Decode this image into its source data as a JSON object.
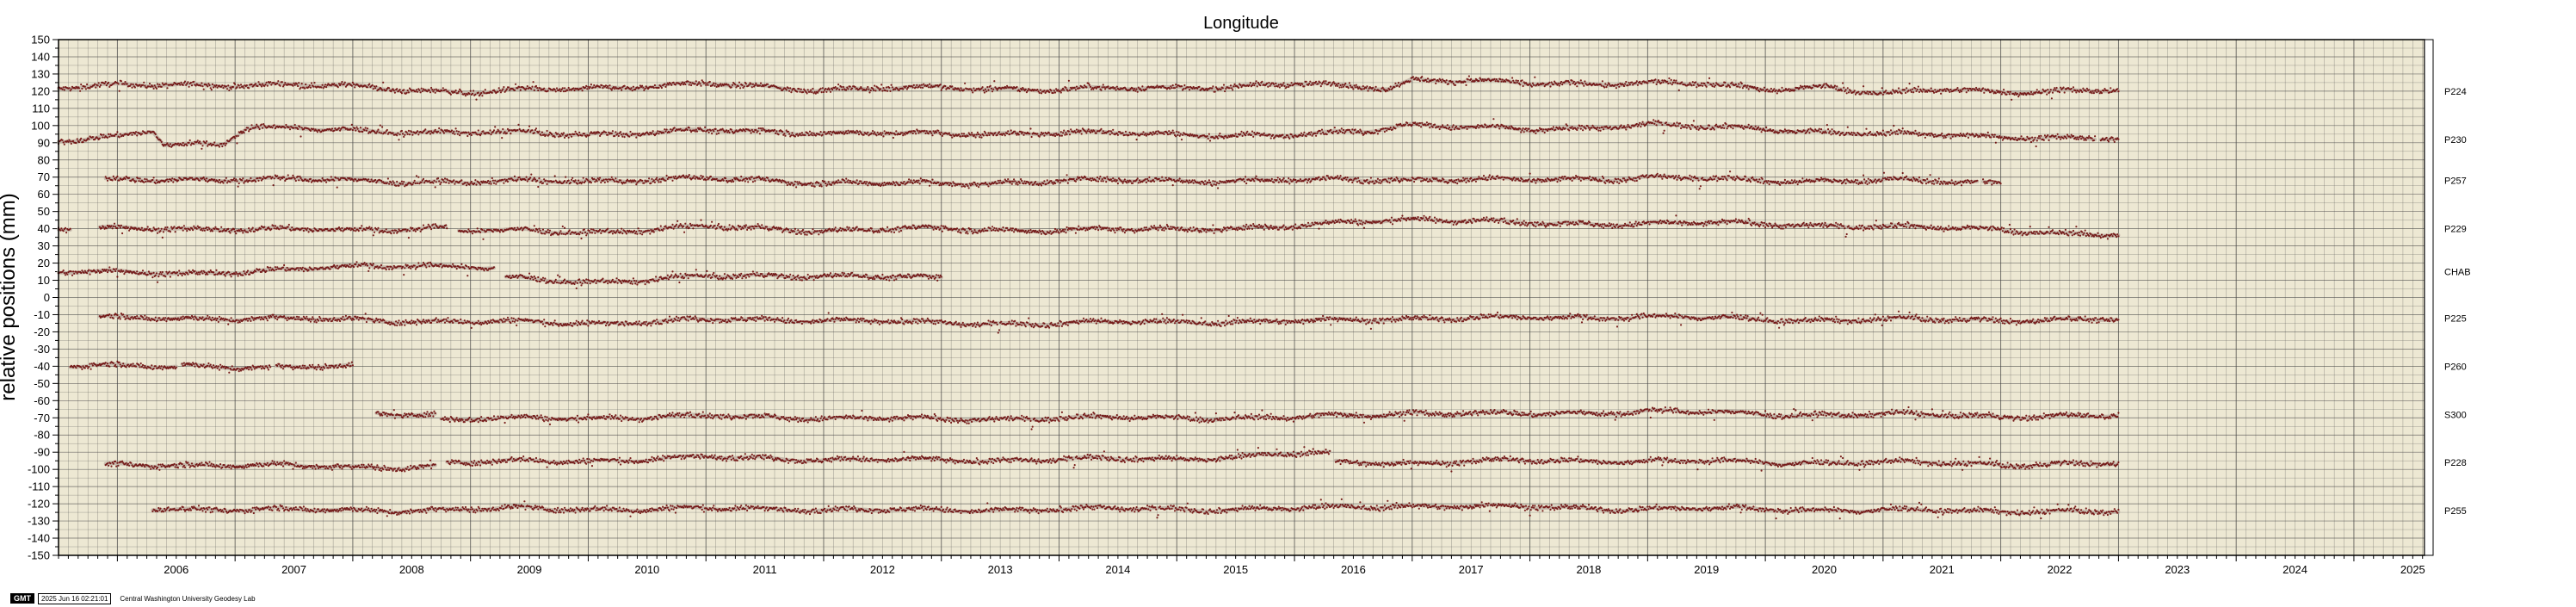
{
  "colors": {
    "plot_background": "#ede8d3",
    "grid": "#444444",
    "points": "#6b0a0a",
    "smooth_band": "#bfb3a6"
  },
  "footer": {
    "badge": "GMT",
    "timestamp": "2025 Jun 16 02:21:01",
    "org": "Central Washington University Geodesy Lab"
  },
  "chart_data": {
    "type": "scatter",
    "title": "Longitude",
    "xlabel": "",
    "ylabel": "relative positions (mm)",
    "xlim": [
      2005.5,
      2025.6
    ],
    "ylim": [
      -150,
      150
    ],
    "x_ticks": [
      "2006",
      "2007",
      "2008",
      "2009",
      "2010",
      "2011",
      "2012",
      "2013",
      "2014",
      "2015",
      "2016",
      "2017",
      "2018",
      "2019",
      "2020",
      "2021",
      "2022",
      "2023",
      "2024",
      "2025"
    ],
    "y_ticks": [
      "150",
      "140",
      "130",
      "120",
      "110",
      "100",
      "90",
      "80",
      "70",
      "60",
      "50",
      "40",
      "30",
      "20",
      "10",
      "0",
      "-10",
      "-20",
      "-30",
      "-40",
      "-50",
      "-60",
      "-70",
      "-80",
      "-90",
      "-100",
      "-110",
      "-120",
      "-130",
      "-140",
      "-150"
    ],
    "grid": true,
    "legend": "station labels at right edge",
    "series": [
      {
        "name": "P224",
        "label_y": 120,
        "segments": [
          {
            "start": 2005.5,
            "end": 2023.0,
            "anchors": [
              [
                2005.5,
                122
              ],
              [
                2006.5,
                124
              ],
              [
                2008.0,
                123
              ],
              [
                2009.0,
                119
              ],
              [
                2010.0,
                122
              ],
              [
                2011.0,
                124
              ],
              [
                2012.0,
                121
              ],
              [
                2013.0,
                122
              ],
              [
                2014.0,
                121
              ],
              [
                2015.0,
                122
              ],
              [
                2016.0,
                124
              ],
              [
                2016.8,
                122
              ],
              [
                2017.0,
                127
              ],
              [
                2017.5,
                126
              ],
              [
                2018.0,
                124
              ],
              [
                2019.0,
                125
              ],
              [
                2019.5,
                124
              ],
              [
                2020.0,
                121
              ],
              [
                2020.5,
                123
              ],
              [
                2021.0,
                118
              ],
              [
                2021.5,
                121
              ],
              [
                2022.0,
                120
              ],
              [
                2022.5,
                120
              ],
              [
                2023.0,
                120
              ]
            ]
          }
        ]
      },
      {
        "name": "P230",
        "label_y": 92,
        "segments": [
          {
            "start": 2005.5,
            "end": 2022.8,
            "anchors": [
              [
                2005.5,
                91
              ],
              [
                2006.0,
                93
              ],
              [
                2006.3,
                97
              ],
              [
                2006.4,
                89
              ],
              [
                2006.9,
                90
              ],
              [
                2007.1,
                99
              ],
              [
                2008.0,
                97
              ],
              [
                2009.0,
                96
              ],
              [
                2010.0,
                95
              ],
              [
                2011.0,
                97
              ],
              [
                2012.0,
                96
              ],
              [
                2013.0,
                95
              ],
              [
                2014.0,
                96
              ],
              [
                2015.0,
                95
              ],
              [
                2016.0,
                94
              ],
              [
                2016.6,
                97
              ],
              [
                2017.0,
                101
              ],
              [
                2017.5,
                99
              ],
              [
                2018.0,
                97
              ],
              [
                2019.0,
                101
              ],
              [
                2019.5,
                99
              ],
              [
                2020.0,
                98
              ],
              [
                2021.0,
                95
              ],
              [
                2022.0,
                94
              ],
              [
                2022.8,
                92
              ]
            ]
          },
          {
            "start": 2022.85,
            "end": 2023.0,
            "anchors": [
              [
                2022.85,
                92
              ],
              [
                2023.0,
                92
              ]
            ]
          }
        ]
      },
      {
        "name": "P257",
        "label_y": 68,
        "segments": [
          {
            "start": 2005.9,
            "end": 2021.8,
            "anchors": [
              [
                2005.9,
                68
              ],
              [
                2007.0,
                69
              ],
              [
                2008.0,
                68
              ],
              [
                2009.0,
                67
              ],
              [
                2010.0,
                68
              ],
              [
                2011.0,
                69
              ],
              [
                2012.0,
                67
              ],
              [
                2013.0,
                66
              ],
              [
                2014.0,
                68
              ],
              [
                2015.0,
                68
              ],
              [
                2016.0,
                68
              ],
              [
                2017.0,
                69
              ],
              [
                2018.0,
                68
              ],
              [
                2019.0,
                70
              ],
              [
                2020.0,
                68
              ],
              [
                2021.0,
                68
              ],
              [
                2021.8,
                67
              ]
            ]
          },
          {
            "start": 2021.85,
            "end": 2022.0,
            "anchors": [
              [
                2021.85,
                67
              ],
              [
                2022.0,
                67
              ]
            ]
          }
        ]
      },
      {
        "name": "P229",
        "label_y": 40,
        "segments": [
          {
            "start": 2005.5,
            "end": 2005.6,
            "anchors": [
              [
                2005.5,
                40
              ],
              [
                2005.6,
                40
              ]
            ]
          },
          {
            "start": 2005.85,
            "end": 2008.8,
            "anchors": [
              [
                2005.85,
                40
              ],
              [
                2007.0,
                40
              ],
              [
                2008.0,
                39
              ],
              [
                2008.8,
                41
              ]
            ]
          },
          {
            "start": 2008.9,
            "end": 2023.0,
            "anchors": [
              [
                2008.9,
                39
              ],
              [
                2010.0,
                38
              ],
              [
                2011.0,
                41
              ],
              [
                2012.0,
                39
              ],
              [
                2013.0,
                40
              ],
              [
                2014.0,
                39
              ],
              [
                2015.0,
                40
              ],
              [
                2016.0,
                41
              ],
              [
                2016.5,
                44
              ],
              [
                2017.0,
                46
              ],
              [
                2018.0,
                43
              ],
              [
                2019.0,
                43
              ],
              [
                2020.0,
                43
              ],
              [
                2021.0,
                41
              ],
              [
                2022.0,
                40
              ],
              [
                2022.5,
                37
              ],
              [
                2023.0,
                36
              ]
            ]
          }
        ]
      },
      {
        "name": "CHAB",
        "label_y": 15,
        "segments": [
          {
            "start": 2005.5,
            "end": 2009.2,
            "anchors": [
              [
                2005.5,
                15
              ],
              [
                2006.5,
                14
              ],
              [
                2007.5,
                16
              ],
              [
                2008.0,
                18
              ],
              [
                2008.5,
                19
              ],
              [
                2009.2,
                17
              ]
            ]
          },
          {
            "start": 2009.3,
            "end": 2013.0,
            "anchors": [
              [
                2009.3,
                11
              ],
              [
                2010.0,
                9
              ],
              [
                2011.0,
                12
              ],
              [
                2012.0,
                13
              ],
              [
                2013.0,
                11
              ]
            ]
          }
        ]
      },
      {
        "name": "P225",
        "label_y": -12,
        "segments": [
          {
            "start": 2005.85,
            "end": 2023.0,
            "anchors": [
              [
                2005.85,
                -12
              ],
              [
                2007.0,
                -12
              ],
              [
                2008.0,
                -13
              ],
              [
                2009.0,
                -14
              ],
              [
                2010.0,
                -15
              ],
              [
                2011.0,
                -13
              ],
              [
                2012.0,
                -13
              ],
              [
                2013.0,
                -15
              ],
              [
                2014.0,
                -15
              ],
              [
                2015.0,
                -14
              ],
              [
                2016.0,
                -14
              ],
              [
                2017.0,
                -12
              ],
              [
                2018.0,
                -12
              ],
              [
                2019.0,
                -11
              ],
              [
                2020.0,
                -13
              ],
              [
                2021.0,
                -13
              ],
              [
                2022.0,
                -13
              ],
              [
                2023.0,
                -13
              ]
            ]
          }
        ]
      },
      {
        "name": "P260",
        "label_y": -40,
        "segments": [
          {
            "start": 2005.6,
            "end": 2006.5,
            "anchors": [
              [
                2005.6,
                -40
              ],
              [
                2006.5,
                -40
              ]
            ]
          },
          {
            "start": 2006.55,
            "end": 2007.3,
            "anchors": [
              [
                2006.55,
                -39
              ],
              [
                2007.3,
                -41
              ]
            ]
          },
          {
            "start": 2007.35,
            "end": 2008.0,
            "anchors": [
              [
                2007.35,
                -41
              ],
              [
                2008.0,
                -40
              ]
            ]
          }
        ]
      },
      {
        "name": "S300",
        "label_y": -68,
        "segments": [
          {
            "start": 2008.2,
            "end": 2008.7,
            "anchors": [
              [
                2008.2,
                -67
              ],
              [
                2008.7,
                -68
              ]
            ]
          },
          {
            "start": 2008.75,
            "end": 2023.0,
            "anchors": [
              [
                2008.75,
                -71
              ],
              [
                2010.0,
                -70
              ],
              [
                2011.0,
                -69
              ],
              [
                2012.0,
                -70
              ],
              [
                2013.0,
                -71
              ],
              [
                2014.0,
                -70
              ],
              [
                2015.0,
                -70
              ],
              [
                2016.0,
                -70
              ],
              [
                2017.0,
                -67
              ],
              [
                2018.0,
                -68
              ],
              [
                2019.0,
                -66
              ],
              [
                2020.0,
                -68
              ],
              [
                2021.0,
                -68
              ],
              [
                2022.0,
                -69
              ],
              [
                2023.0,
                -69
              ]
            ]
          }
        ]
      },
      {
        "name": "P228",
        "label_y": -96,
        "segments": [
          {
            "start": 2005.9,
            "end": 2008.7,
            "anchors": [
              [
                2005.9,
                -98
              ],
              [
                2007.0,
                -97
              ],
              [
                2008.0,
                -99
              ],
              [
                2008.7,
                -98
              ]
            ]
          },
          {
            "start": 2008.8,
            "end": 2016.3,
            "anchors": [
              [
                2008.8,
                -96
              ],
              [
                2010.0,
                -95
              ],
              [
                2011.0,
                -93
              ],
              [
                2012.0,
                -94
              ],
              [
                2013.0,
                -95
              ],
              [
                2014.0,
                -94
              ],
              [
                2015.0,
                -94
              ],
              [
                2016.0,
                -91
              ],
              [
                2016.3,
                -91
              ]
            ]
          },
          {
            "start": 2016.35,
            "end": 2023.0,
            "anchors": [
              [
                2016.35,
                -96
              ],
              [
                2017.0,
                -96
              ],
              [
                2018.0,
                -95
              ],
              [
                2019.0,
                -95
              ],
              [
                2020.0,
                -96
              ],
              [
                2021.0,
                -96
              ],
              [
                2022.0,
                -97
              ],
              [
                2023.0,
                -97
              ]
            ]
          }
        ]
      },
      {
        "name": "P255",
        "label_y": -124,
        "segments": [
          {
            "start": 2006.3,
            "end": 2023.0,
            "anchors": [
              [
                2006.3,
                -123
              ],
              [
                2007.0,
                -123
              ],
              [
                2008.0,
                -124
              ],
              [
                2009.0,
                -123
              ],
              [
                2010.0,
                -123
              ],
              [
                2011.0,
                -123
              ],
              [
                2012.0,
                -123
              ],
              [
                2013.0,
                -124
              ],
              [
                2014.0,
                -123
              ],
              [
                2015.0,
                -123
              ],
              [
                2016.0,
                -123
              ],
              [
                2017.0,
                -121
              ],
              [
                2018.0,
                -122
              ],
              [
                2019.0,
                -123
              ],
              [
                2020.0,
                -123
              ],
              [
                2021.0,
                -124
              ],
              [
                2022.0,
                -124
              ],
              [
                2023.0,
                -125
              ]
            ]
          }
        ]
      }
    ]
  }
}
